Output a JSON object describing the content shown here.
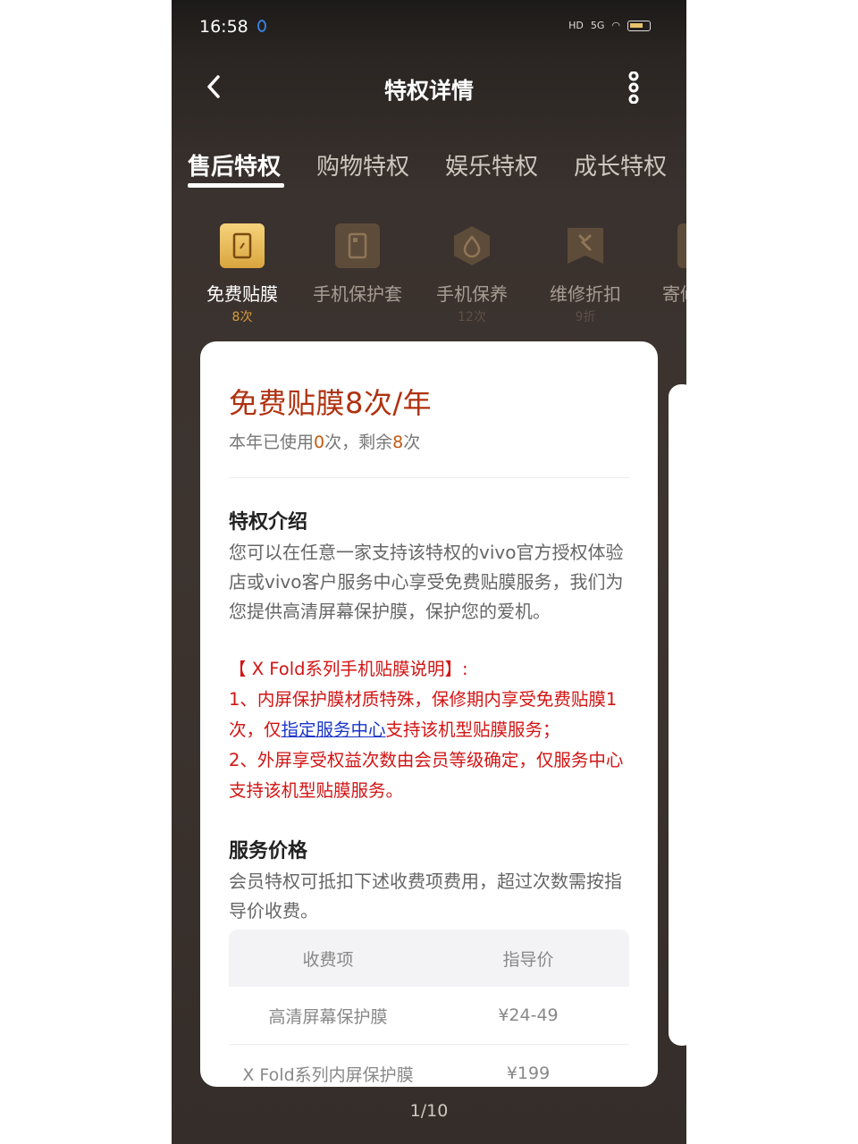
{
  "status_bar": {
    "time": "16:58",
    "network": "5G"
  },
  "header": {
    "title": "特权详情"
  },
  "tabs": [
    {
      "label": "售后特权"
    },
    {
      "label": "购物特权"
    },
    {
      "label": "娱乐特权"
    },
    {
      "label": "成长特权"
    }
  ],
  "privileges": [
    {
      "label": "免费贴膜",
      "count": "8次"
    },
    {
      "label": "手机保护套",
      "count": ""
    },
    {
      "label": "手机保养",
      "count": "12次"
    },
    {
      "label": "维修折扣",
      "count": "9折"
    },
    {
      "label": "寄修",
      "count": ""
    }
  ],
  "card": {
    "title": "免费贴膜8次/年",
    "usage_prefix": "本年已使用",
    "used": "0",
    "usage_mid": "次，剩余",
    "remaining": "8",
    "usage_suffix": "次",
    "intro_title": "特权介绍",
    "intro_text": "您可以在任意一家支持该特权的vivo官方授权体验店或vivo客户服务中心享受免费贴膜服务，我们为您提供高清屏幕保护膜，保护您的爱机。",
    "note_heading": "【 X Fold系列手机贴膜说明】:",
    "note_1_before": "1、内屏保护膜材质特殊，保修期内享受免费贴膜1次，仅",
    "note_1_link": "指定服务中心",
    "note_1_after": "支持该机型贴膜服务；",
    "note_2": "2、外屏享受权益次数由会员等级确定，仅服务中心支持该机型贴膜服务。",
    "price_title": "服务价格",
    "price_text": "会员特权可抵扣下述收费项费用，超过次数需按指导价收费。",
    "table_headers": {
      "item": "收费项",
      "price": "指导价"
    },
    "table_rows": [
      {
        "item": "高清屏幕保护膜",
        "price": "¥24-49"
      },
      {
        "item": "X Fold系列内屏保护膜",
        "price": "¥199"
      }
    ]
  },
  "pager": "1/10",
  "colors": {
    "accent_red": "#b0310f",
    "link_blue": "#1a35c8",
    "gold": "#d59b3a"
  }
}
